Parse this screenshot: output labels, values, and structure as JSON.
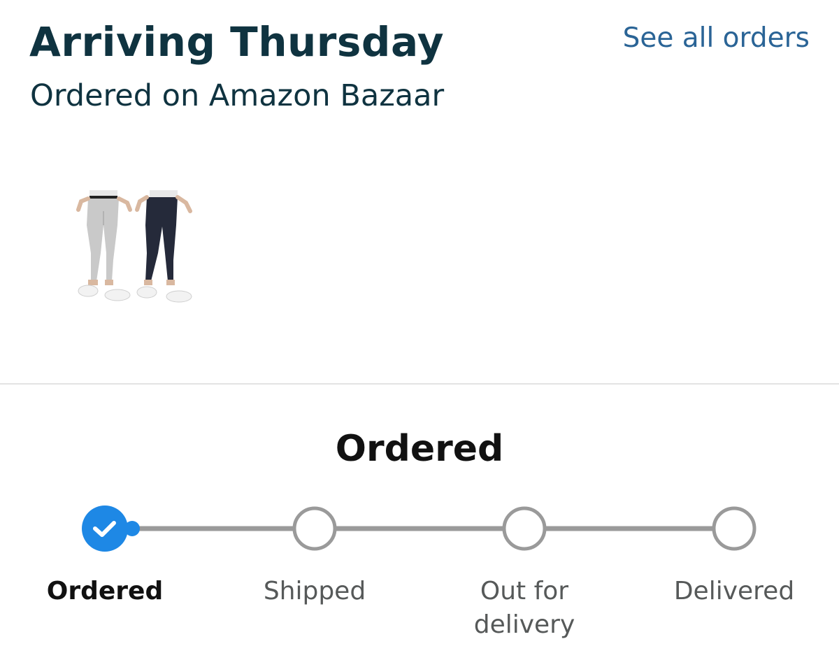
{
  "header": {
    "title": "Arriving Thursday",
    "subtitle": "Ordered on Amazon Bazaar",
    "see_all_link": "See all orders",
    "link_color": "#2a6496",
    "title_color": "#0f3340"
  },
  "product": {
    "image_icon": "pants-product-thumbnail"
  },
  "tracking": {
    "current_status": "Ordered",
    "active_color": "#1e88e5",
    "inactive_color": "#9a9a9a",
    "progress_fraction": 0,
    "steps": [
      {
        "label": "Ordered",
        "state": "complete"
      },
      {
        "label": "Shipped",
        "state": "pending"
      },
      {
        "label": "Out for\ndelivery",
        "state": "pending"
      },
      {
        "label": "Delivered",
        "state": "pending"
      }
    ]
  }
}
